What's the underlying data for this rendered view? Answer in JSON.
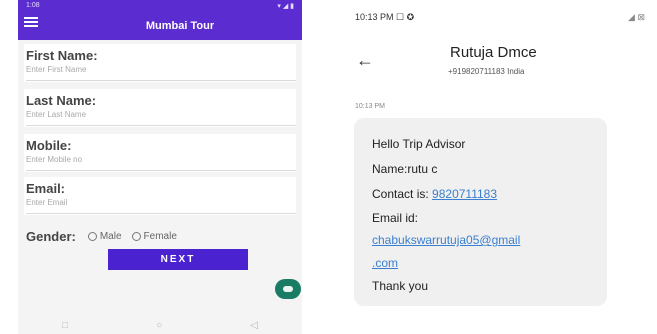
{
  "phone": {
    "statusbar": {
      "left": "1:08",
      "right": "▾ ◢ ▮"
    },
    "app_title": "Mumbai Tour",
    "fields": [
      {
        "label": "First Name:",
        "hint": "Enter First Name"
      },
      {
        "label": "Last Name:",
        "hint": "Enter Last Name"
      },
      {
        "label": "Mobile:",
        "hint": "Enter Mobile no"
      },
      {
        "label": "Email:",
        "hint": "Enter Email"
      }
    ],
    "gender": {
      "label": "Gender:",
      "options": [
        "Male",
        "Female"
      ]
    },
    "next_label": "NEXT",
    "nav": [
      "□",
      "○",
      "◁"
    ]
  },
  "chat": {
    "time": "10:13 PM ☐ ✪",
    "status_icons": "◢ ⊠",
    "contact_name": "Rutuja Dmce",
    "contact_number": "+919820711183 India",
    "message_time": "10:13 PM",
    "message": {
      "line1": "Hello Trip Advisor",
      "line2": "Name:rutu c",
      "contact_prefix": "Contact is:",
      "contact_link": "9820711183",
      "email_label": "Email id:",
      "email_link_1": "chabukswarrutuja05@gmail",
      "email_link_2": ".com",
      "closing": "Thank you"
    }
  },
  "colors": {
    "appbar": "#5b2ccf",
    "button": "#4b22d0",
    "fab": "#1b7c66",
    "link": "#3a7fcf"
  }
}
